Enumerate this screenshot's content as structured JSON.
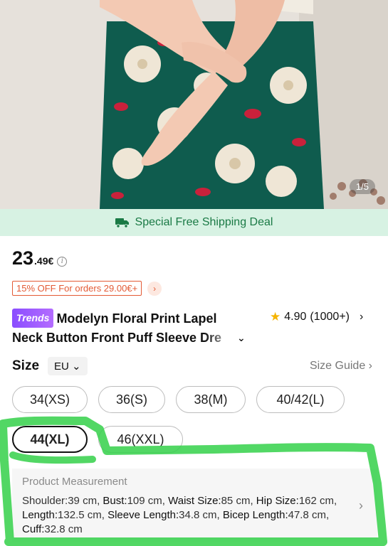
{
  "image": {
    "pager": "1/5"
  },
  "shipping": {
    "label": "Special Free Shipping Deal"
  },
  "price": {
    "integer": "23",
    "decimal": ".49€",
    "info": "i"
  },
  "promo": {
    "label": "15% OFF For orders 29.00€+",
    "arrow": "›"
  },
  "product": {
    "badge": "Trends",
    "title_line1": "Modelyn Floral Print Lapel",
    "title_line2": "Neck Button Front Puff Sleeve Dre",
    "expand": "⌄"
  },
  "rating": {
    "star": "★",
    "value": "4.90",
    "count": "(1000+)",
    "arrow": "›"
  },
  "size": {
    "label": "Size",
    "region": "EU ⌄",
    "guide": "Size Guide  ›",
    "options": [
      "34(XS)",
      "36(S)",
      "38(M)",
      "40/42(L)",
      "44(XL)",
      "46(XXL)"
    ],
    "selected": "44(XL)"
  },
  "measurement": {
    "title": "Product Measurement",
    "items": [
      {
        "k": "Shoulder:",
        "v": "39 cm, "
      },
      {
        "k": "Bust:",
        "v": "109 cm, "
      },
      {
        "k": "Waist Size:",
        "v": "85 cm, "
      },
      {
        "k": "Hip Size:",
        "v": "162 cm, "
      },
      {
        "k": "Length:",
        "v": "132.5 cm, "
      },
      {
        "k": "Sleeve Length:",
        "v": "34.8 cm, "
      },
      {
        "k": "Bicep Length:",
        "v": "47.8 cm, "
      },
      {
        "k": "Cuff:",
        "v": "32.8 cm"
      }
    ],
    "arrow": "›"
  },
  "colors": {
    "shipping_bg": "#d7f2e3",
    "shipping_text": "#1a7a45",
    "promo": "#e35a35",
    "trends_badge": "#9b59ff",
    "star": "#f5b400",
    "highlight": "#34d14a"
  }
}
